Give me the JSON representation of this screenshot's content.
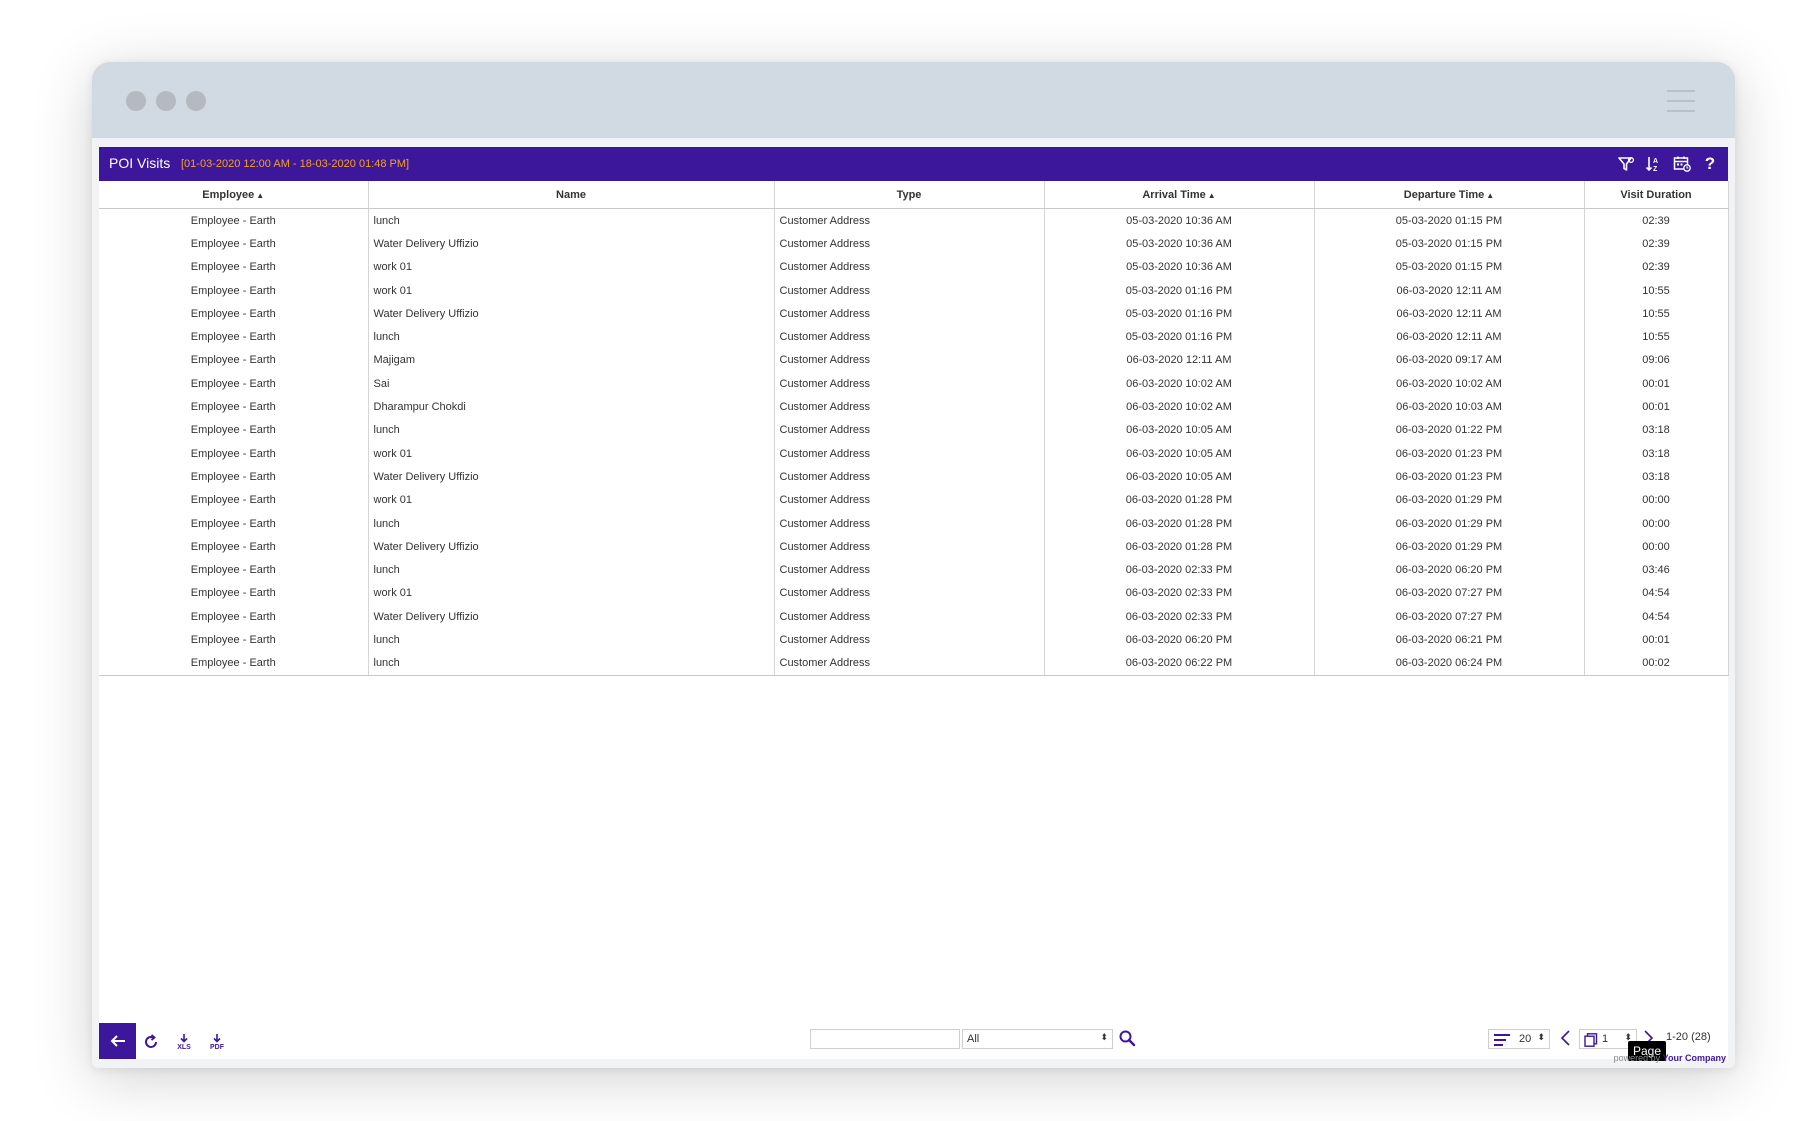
{
  "header": {
    "title": "POI Visits",
    "date_range": "[01-03-2020 12:00 AM - 18-03-2020 01:48 PM]",
    "help_label": "?"
  },
  "columns": [
    "Employee",
    "Name",
    "Type",
    "Arrival Time",
    "Departure Time",
    "Visit Duration"
  ],
  "sorted_indicator": "▲",
  "rows": [
    [
      "Employee - Earth",
      "lunch",
      "Customer Address",
      "05-03-2020 10:36 AM",
      "05-03-2020 01:15 PM",
      "02:39"
    ],
    [
      "Employee - Earth",
      "Water Delivery Uffizio",
      "Customer Address",
      "05-03-2020 10:36 AM",
      "05-03-2020 01:15 PM",
      "02:39"
    ],
    [
      "Employee - Earth",
      "work 01",
      "Customer Address",
      "05-03-2020 10:36 AM",
      "05-03-2020 01:15 PM",
      "02:39"
    ],
    [
      "Employee - Earth",
      "work 01",
      "Customer Address",
      "05-03-2020 01:16 PM",
      "06-03-2020 12:11 AM",
      "10:55"
    ],
    [
      "Employee - Earth",
      "Water Delivery Uffizio",
      "Customer Address",
      "05-03-2020 01:16 PM",
      "06-03-2020 12:11 AM",
      "10:55"
    ],
    [
      "Employee - Earth",
      "lunch",
      "Customer Address",
      "05-03-2020 01:16 PM",
      "06-03-2020 12:11 AM",
      "10:55"
    ],
    [
      "Employee - Earth",
      "Majigam",
      "Customer Address",
      "06-03-2020 12:11 AM",
      "06-03-2020 09:17 AM",
      "09:06"
    ],
    [
      "Employee - Earth",
      "Sai",
      "Customer Address",
      "06-03-2020 10:02 AM",
      "06-03-2020 10:02 AM",
      "00:01"
    ],
    [
      "Employee - Earth",
      "Dharampur Chokdi",
      "Customer Address",
      "06-03-2020 10:02 AM",
      "06-03-2020 10:03 AM",
      "00:01"
    ],
    [
      "Employee - Earth",
      "lunch",
      "Customer Address",
      "06-03-2020 10:05 AM",
      "06-03-2020 01:22 PM",
      "03:18"
    ],
    [
      "Employee - Earth",
      "work 01",
      "Customer Address",
      "06-03-2020 10:05 AM",
      "06-03-2020 01:23 PM",
      "03:18"
    ],
    [
      "Employee - Earth",
      "Water Delivery Uffizio",
      "Customer Address",
      "06-03-2020 10:05 AM",
      "06-03-2020 01:23 PM",
      "03:18"
    ],
    [
      "Employee - Earth",
      "work 01",
      "Customer Address",
      "06-03-2020 01:28 PM",
      "06-03-2020 01:29 PM",
      "00:00"
    ],
    [
      "Employee - Earth",
      "lunch",
      "Customer Address",
      "06-03-2020 01:28 PM",
      "06-03-2020 01:29 PM",
      "00:00"
    ],
    [
      "Employee - Earth",
      "Water Delivery Uffizio",
      "Customer Address",
      "06-03-2020 01:28 PM",
      "06-03-2020 01:29 PM",
      "00:00"
    ],
    [
      "Employee - Earth",
      "lunch",
      "Customer Address",
      "06-03-2020 02:33 PM",
      "06-03-2020 06:20 PM",
      "03:46"
    ],
    [
      "Employee - Earth",
      "work 01",
      "Customer Address",
      "06-03-2020 02:33 PM",
      "06-03-2020 07:27 PM",
      "04:54"
    ],
    [
      "Employee - Earth",
      "Water Delivery Uffizio",
      "Customer Address",
      "06-03-2020 02:33 PM",
      "06-03-2020 07:27 PM",
      "04:54"
    ],
    [
      "Employee - Earth",
      "lunch",
      "Customer Address",
      "06-03-2020 06:20 PM",
      "06-03-2020 06:21 PM",
      "00:01"
    ],
    [
      "Employee - Earth",
      "lunch",
      "Customer Address",
      "06-03-2020 06:22 PM",
      "06-03-2020 06:24 PM",
      "00:02"
    ]
  ],
  "footer": {
    "xls_label": "XLS",
    "pdf_label": "PDF",
    "search_value": "",
    "search_placeholder": "",
    "filter_selected": "All",
    "rows_per_page": "20",
    "page_number": "1",
    "range_text": "1-20 (28)",
    "tooltip": "Page",
    "powered_prefix": "powered by",
    "powered_company": "Your Company"
  },
  "colors": {
    "accent": "#3c179c",
    "date_range": "#f4a21e",
    "titlebar": "#d1d9e2"
  },
  "icons": [
    "filter-icon",
    "sort-icon",
    "calendar-icon",
    "help-icon",
    "back-arrow-icon",
    "refresh-icon",
    "download-xls-icon",
    "download-pdf-icon",
    "search-icon",
    "rows-lines-icon",
    "chevron-left-icon",
    "page-icon",
    "chevron-right-icon",
    "hamburger-menu-icon"
  ]
}
